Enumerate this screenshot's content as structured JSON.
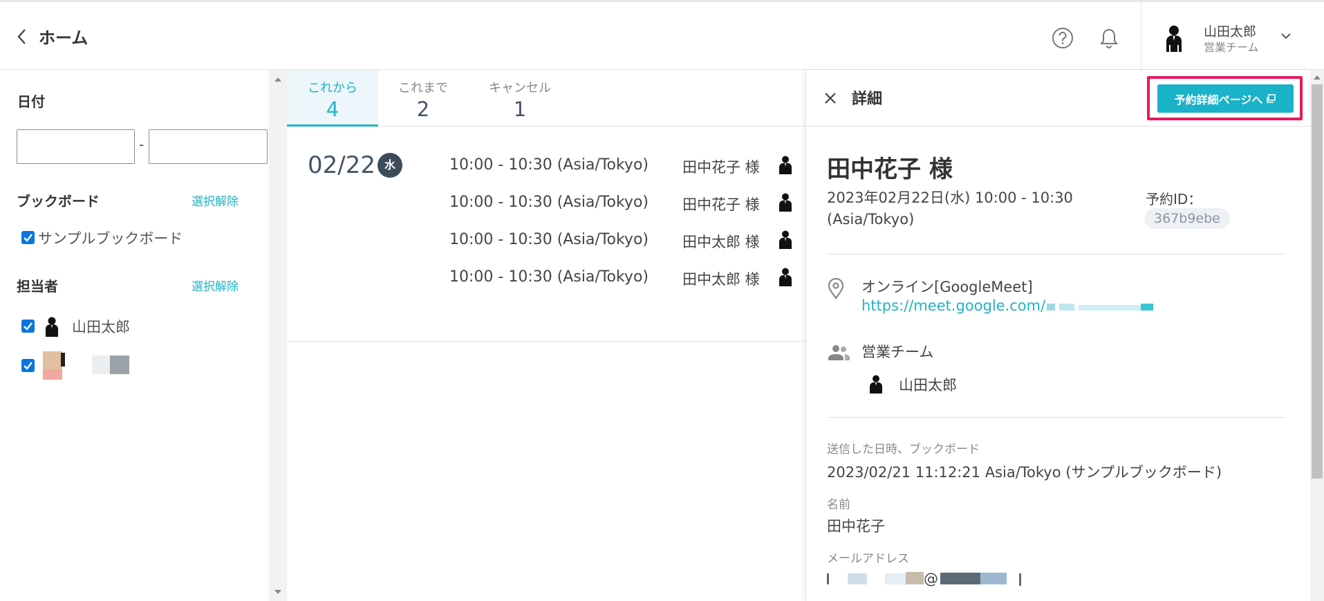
{
  "header": {
    "title": "ホーム",
    "user_name": "山田太郎",
    "user_team": "営業チーム"
  },
  "sidebar": {
    "date_label": "日付",
    "date_separator": "-",
    "date_from_value": "",
    "date_to_value": "",
    "bookboard_label": "ブックボード",
    "bookboard_clear": "選択解除",
    "bookboard_items": [
      {
        "label": "サンプルブックボード",
        "checked": true
      }
    ],
    "assignee_label": "担当者",
    "assignee_clear": "選択解除",
    "assignee_items": [
      {
        "label": "山田太郎",
        "checked": true
      },
      {
        "label": "",
        "checked": true
      }
    ]
  },
  "tabs": [
    {
      "label": "これから",
      "count": "4",
      "active": true
    },
    {
      "label": "これまで",
      "count": "2",
      "active": false
    },
    {
      "label": "キャンセル",
      "count": "1",
      "active": false
    }
  ],
  "schedule": {
    "date": "02/22",
    "weekday": "水",
    "bookings": [
      {
        "time": "10:00 - 10:30 (Asia/Tokyo)",
        "name": "田中花子 様"
      },
      {
        "time": "10:00 - 10:30 (Asia/Tokyo)",
        "name": "田中花子 様"
      },
      {
        "time": "10:00 - 10:30 (Asia/Tokyo)",
        "name": "田中太郎 様"
      },
      {
        "time": "10:00 - 10:30 (Asia/Tokyo)",
        "name": "田中太郎 様"
      }
    ]
  },
  "detail": {
    "title": "詳細",
    "open_page_button": "予約詳細ページへ",
    "guest_name": "田中花子 様",
    "datetime_line1": "2023年02月22日(水) 10:00 - 10:30",
    "datetime_line2": "(Asia/Tokyo)",
    "booking_id_label": "予約ID：",
    "booking_id": "367b9ebe",
    "location_type": "オンライン[GoogleMeet]",
    "meet_link": "https://meet.google.com/",
    "team": "営業チーム",
    "member": "山田太郎",
    "sent_label": "送信した日時、ブックボード",
    "sent_value": "2023/02/21 11:12:21 Asia/Tokyo (サンプルブックボード)",
    "name_label": "名前",
    "name_value": "田中花子",
    "email_label": "メールアドレス",
    "email_value": "@"
  },
  "colors": {
    "accent": "#1fb3c9",
    "highlight": "#e5195e",
    "checkbox": "#0b74de"
  }
}
